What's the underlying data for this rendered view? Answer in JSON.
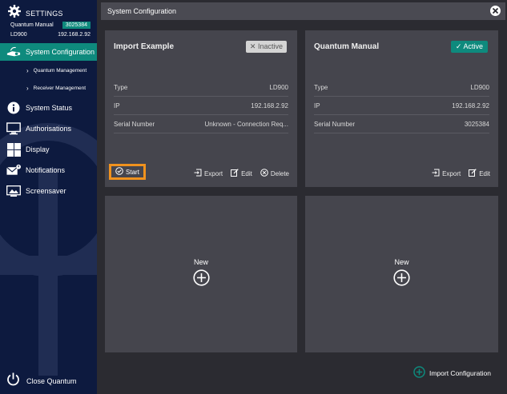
{
  "sidebar": {
    "header_label": "SETTINGS",
    "device_name": "Quantum Manual",
    "device_serial": "3025384",
    "device_type": "LD900",
    "device_ip": "192.168.2.92",
    "items": [
      {
        "label": "System Configuration",
        "icon": "projector-icon",
        "active": true
      },
      {
        "label": "Quantum Management",
        "sub": true
      },
      {
        "label": "Receiver Management",
        "sub": true
      },
      {
        "label": "System Status",
        "icon": "info-icon"
      },
      {
        "label": "Authorisations",
        "icon": "monitor-icon"
      },
      {
        "label": "Display",
        "icon": "display-grid-icon"
      },
      {
        "label": "Notifications",
        "icon": "envelope-icon"
      },
      {
        "label": "Screensaver",
        "icon": "screensaver-icon"
      }
    ],
    "close_label": "Close Quantum"
  },
  "topbar": {
    "title": "System Configuration"
  },
  "cards": [
    {
      "title": "Import Example",
      "status": "Inactive",
      "rows": [
        {
          "label": "Type",
          "value": "LD900"
        },
        {
          "label": "IP",
          "value": "192.168.2.92"
        },
        {
          "label": "Serial Number",
          "value": "Unknown - Connection Req..."
        }
      ],
      "start_label": "Start",
      "export_label": "Export",
      "edit_label": "Edit",
      "delete_label": "Delete"
    },
    {
      "title": "Quantum Manual",
      "status": "Active",
      "rows": [
        {
          "label": "Type",
          "value": "LD900"
        },
        {
          "label": "IP",
          "value": "192.168.2.92"
        },
        {
          "label": "Serial Number",
          "value": "3025384"
        }
      ],
      "export_label": "Export",
      "edit_label": "Edit"
    }
  ],
  "new_cards": [
    {
      "label": "New"
    },
    {
      "label": "New"
    }
  ],
  "import_config_label": "Import Configuration",
  "colors": {
    "accent": "#0e8a7d",
    "highlight": "#f0921e",
    "sidebar": "#0d1a3f",
    "card": "#45454d",
    "background": "#2b2b31"
  }
}
